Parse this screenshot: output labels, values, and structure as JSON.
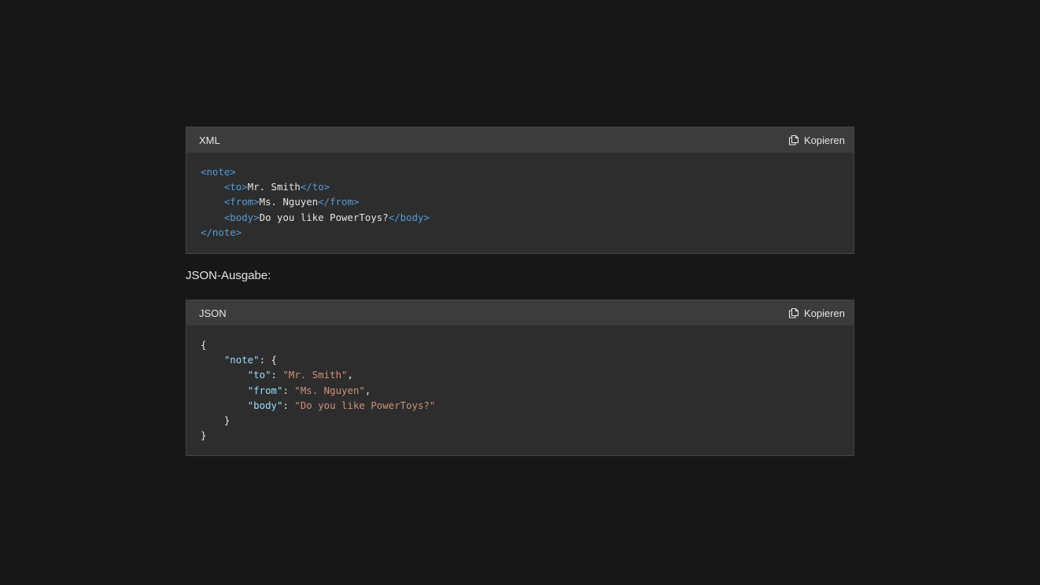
{
  "xml_block": {
    "language": "XML",
    "copy_label": "Kopieren",
    "lines": [
      {
        "indent": "",
        "open": "<note>",
        "text": "",
        "close": ""
      },
      {
        "indent": "    ",
        "open": "<to>",
        "text": "Mr. Smith",
        "close": "</to>"
      },
      {
        "indent": "    ",
        "open": "<from>",
        "text": "Ms. Nguyen",
        "close": "</from>"
      },
      {
        "indent": "    ",
        "open": "<body>",
        "text": "Do you like PowerToys?",
        "close": "</body>"
      },
      {
        "indent": "",
        "open": "</note>",
        "text": "",
        "close": ""
      }
    ]
  },
  "json_heading": "JSON-Ausgabe:",
  "json_block": {
    "language": "JSON",
    "copy_label": "Kopieren",
    "lines": [
      {
        "indent": "",
        "key": "",
        "sep": "",
        "value": "",
        "tail": "{"
      },
      {
        "indent": "    ",
        "key": "\"note\"",
        "sep": ": ",
        "value": "",
        "tail": "{"
      },
      {
        "indent": "        ",
        "key": "\"to\"",
        "sep": ": ",
        "value": "\"Mr. Smith\"",
        "tail": ","
      },
      {
        "indent": "        ",
        "key": "\"from\"",
        "sep": ": ",
        "value": "\"Ms. Nguyen\"",
        "tail": ","
      },
      {
        "indent": "        ",
        "key": "\"body\"",
        "sep": ": ",
        "value": "\"Do you like PowerToys?\"",
        "tail": ""
      },
      {
        "indent": "    ",
        "key": "",
        "sep": "",
        "value": "",
        "tail": "}"
      },
      {
        "indent": "",
        "key": "",
        "sep": "",
        "value": "",
        "tail": "}"
      }
    ]
  },
  "colors": {
    "background": "#171717",
    "block_background": "#2d2d2d",
    "header_background": "#3c3c3c",
    "xml_tag": "#569cd6",
    "json_key": "#9cdcfe",
    "json_string": "#ce9178",
    "text": "#e6e6e6"
  },
  "icons": {
    "copy": "copy-icon"
  }
}
